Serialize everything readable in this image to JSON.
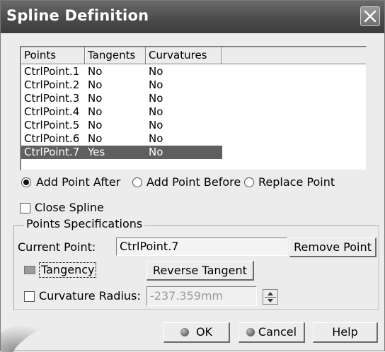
{
  "window": {
    "title": "Spline Definition"
  },
  "table": {
    "columns": [
      "Points",
      "Tangents",
      "Curvatures"
    ],
    "rows": [
      {
        "point": "CtrlPoint.1",
        "tangent": "No",
        "curvature": "No"
      },
      {
        "point": "CtrlPoint.2",
        "tangent": "No",
        "curvature": "No"
      },
      {
        "point": "CtrlPoint.3",
        "tangent": "No",
        "curvature": "No"
      },
      {
        "point": "CtrlPoint.4",
        "tangent": "No",
        "curvature": "No"
      },
      {
        "point": "CtrlPoint.5",
        "tangent": "No",
        "curvature": "No"
      },
      {
        "point": "CtrlPoint.6",
        "tangent": "No",
        "curvature": "No"
      },
      {
        "point": "CtrlPoint.7",
        "tangent": "Yes",
        "curvature": "No"
      }
    ],
    "selected_row": 7
  },
  "options": {
    "add_after": "Add Point After",
    "add_before": "Add Point Before",
    "replace": "Replace Point",
    "selected": "Add Point After",
    "close_spline": "Close Spline"
  },
  "specs": {
    "legend": "Points Specifications",
    "current_point_label": "Current Point:",
    "current_point_value": "CtrlPoint.7",
    "remove_point": "Remove Point",
    "tangency": "Tangency",
    "reverse_tangent": "Reverse Tangent",
    "curvature_radius_label": "Curvature Radius:",
    "curvature_radius_value": "-237.359mm"
  },
  "footer": {
    "ok": "OK",
    "cancel": "Cancel",
    "help": "Help"
  },
  "colors": {
    "selection": "#5f5f5f",
    "titlebar": "#4c4c4c",
    "dialog_bg": "#ececec"
  },
  "icons": [
    "close-icon",
    "ok-icon",
    "cancel-icon",
    "spinner-icon"
  ]
}
